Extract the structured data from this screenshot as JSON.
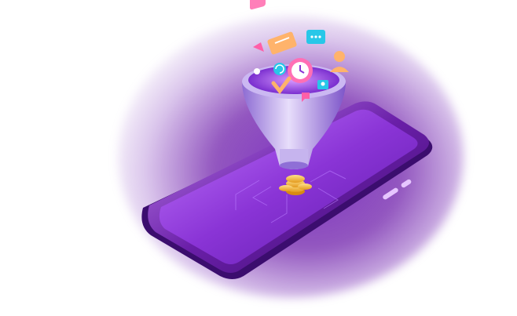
{
  "scene": {
    "subject": "isometric-phone-with-sales-funnel",
    "icons": [
      "user-icon",
      "chat-bubble-icon",
      "message-icon",
      "clock-icon",
      "refresh-icon",
      "checkmark-icon",
      "person-icon",
      "coin-stack-icon"
    ],
    "colors": {
      "background": "#ffffff",
      "glow": "#7a2bbf",
      "phone_frame": "#6a1fa8",
      "screen": "#8a34d6",
      "funnel": "#b9a6e6",
      "coin": "#f4b63a",
      "accent_cyan": "#28c7e8",
      "accent_orange": "#ffb36b",
      "accent_pink": "#ff5fa8"
    }
  }
}
